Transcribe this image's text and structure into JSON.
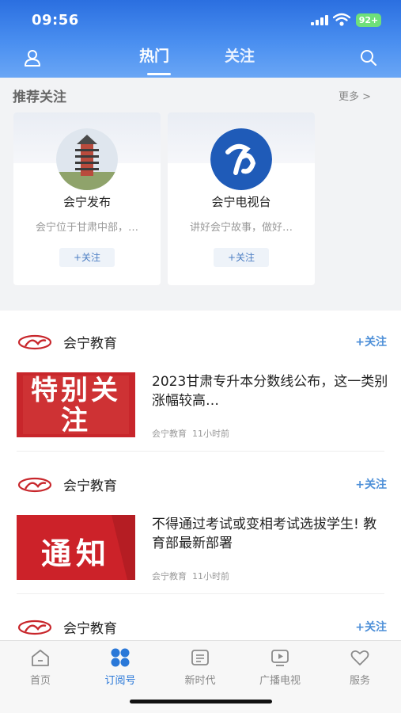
{
  "status_bar": {
    "time": "09:56",
    "battery": "92+"
  },
  "nav": {
    "tabs": [
      "热门",
      "关注"
    ],
    "active_tab": "热门"
  },
  "recommend": {
    "title": "推荐关注",
    "more": "更多 >",
    "cards": [
      {
        "name": "会宁发布",
        "desc": "会宁位于甘肃中部，…",
        "button": "+关注"
      },
      {
        "name": "会宁电视台",
        "desc": "讲好会宁故事，做好…",
        "button": "+关注"
      }
    ]
  },
  "feed": [
    {
      "source": "会宁教育",
      "follow": "+关注",
      "image_text": "特别关注",
      "title": "2023甘肃专升本分数线公布，这一类别涨幅较高…",
      "meta_source": "会宁教育",
      "meta_time": "11小时前"
    },
    {
      "source": "会宁教育",
      "follow": "+关注",
      "image_text": "通知",
      "title": "不得通过考试或变相考试选拔学生! 教育部最新部署",
      "meta_source": "会宁教育",
      "meta_time": "11小时前"
    },
    {
      "source": "会宁教育",
      "follow": "+关注"
    }
  ],
  "tabbar": {
    "items": [
      {
        "label": "首页",
        "icon": "home-icon"
      },
      {
        "label": "订阅号",
        "icon": "grid-icon",
        "active": true
      },
      {
        "label": "新时代",
        "icon": "news-icon"
      },
      {
        "label": "广播电视",
        "icon": "tv-icon"
      },
      {
        "label": "服务",
        "icon": "heart-icon"
      }
    ]
  },
  "colors": {
    "accent": "#2a78d8",
    "header_top": "#2b6fe0",
    "follow": "#4d8fd8",
    "brand_red": "#c8262b"
  }
}
